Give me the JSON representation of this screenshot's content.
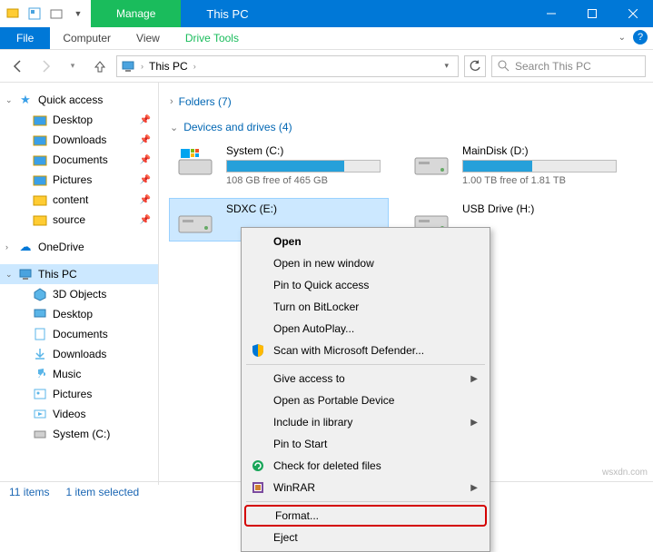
{
  "titlebar": {
    "context_tab": "Manage",
    "title": "This PC"
  },
  "ribbon": {
    "file": "File",
    "tabs": [
      "Computer",
      "View"
    ],
    "context_tab": "Drive Tools"
  },
  "addressbar": {
    "location": "This PC"
  },
  "search": {
    "placeholder": "Search This PC"
  },
  "sidebar": {
    "quick_access": {
      "label": "Quick access",
      "items": [
        {
          "label": "Desktop",
          "pinned": true
        },
        {
          "label": "Downloads",
          "pinned": true
        },
        {
          "label": "Documents",
          "pinned": true
        },
        {
          "label": "Pictures",
          "pinned": true
        },
        {
          "label": "content",
          "pinned": true
        },
        {
          "label": "source",
          "pinned": true
        }
      ]
    },
    "onedrive": {
      "label": "OneDrive"
    },
    "this_pc": {
      "label": "This PC",
      "items": [
        {
          "label": "3D Objects"
        },
        {
          "label": "Desktop"
        },
        {
          "label": "Documents"
        },
        {
          "label": "Downloads"
        },
        {
          "label": "Music"
        },
        {
          "label": "Pictures"
        },
        {
          "label": "Videos"
        },
        {
          "label": "System (C:)"
        }
      ]
    }
  },
  "groups": {
    "folders": {
      "label": "Folders (7)"
    },
    "devices": {
      "label": "Devices and drives (4)",
      "drives": [
        {
          "name": "System (C:)",
          "free": "108 GB free of 465 GB",
          "fill_pct": 77
        },
        {
          "name": "MainDisk (D:)",
          "free": "1.00 TB free of 1.81 TB",
          "fill_pct": 45
        },
        {
          "name": "SDXC (E:)",
          "free": "",
          "fill_pct": 0,
          "selected": true
        },
        {
          "name": "USB Drive (H:)",
          "free": "",
          "fill_pct": 0
        }
      ]
    }
  },
  "context_menu": {
    "items": [
      {
        "label": "Open",
        "bold": true
      },
      {
        "label": "Open in new window"
      },
      {
        "label": "Pin to Quick access"
      },
      {
        "label": "Turn on BitLocker"
      },
      {
        "label": "Open AutoPlay..."
      },
      {
        "label": "Scan with Microsoft Defender...",
        "icon": "shield"
      },
      {
        "sep": true
      },
      {
        "label": "Give access to",
        "submenu": true
      },
      {
        "label": "Open as Portable Device"
      },
      {
        "label": "Include in library",
        "submenu": true
      },
      {
        "label": "Pin to Start"
      },
      {
        "label": "Check for deleted files",
        "icon": "recuva"
      },
      {
        "label": "WinRAR",
        "icon": "winrar",
        "submenu": true
      },
      {
        "sep": true
      },
      {
        "label": "Format...",
        "highlight": true
      },
      {
        "label": "Eject"
      }
    ]
  },
  "status": {
    "count": "11 items",
    "selection": "1 item selected"
  },
  "watermark": "wsxdn.com"
}
